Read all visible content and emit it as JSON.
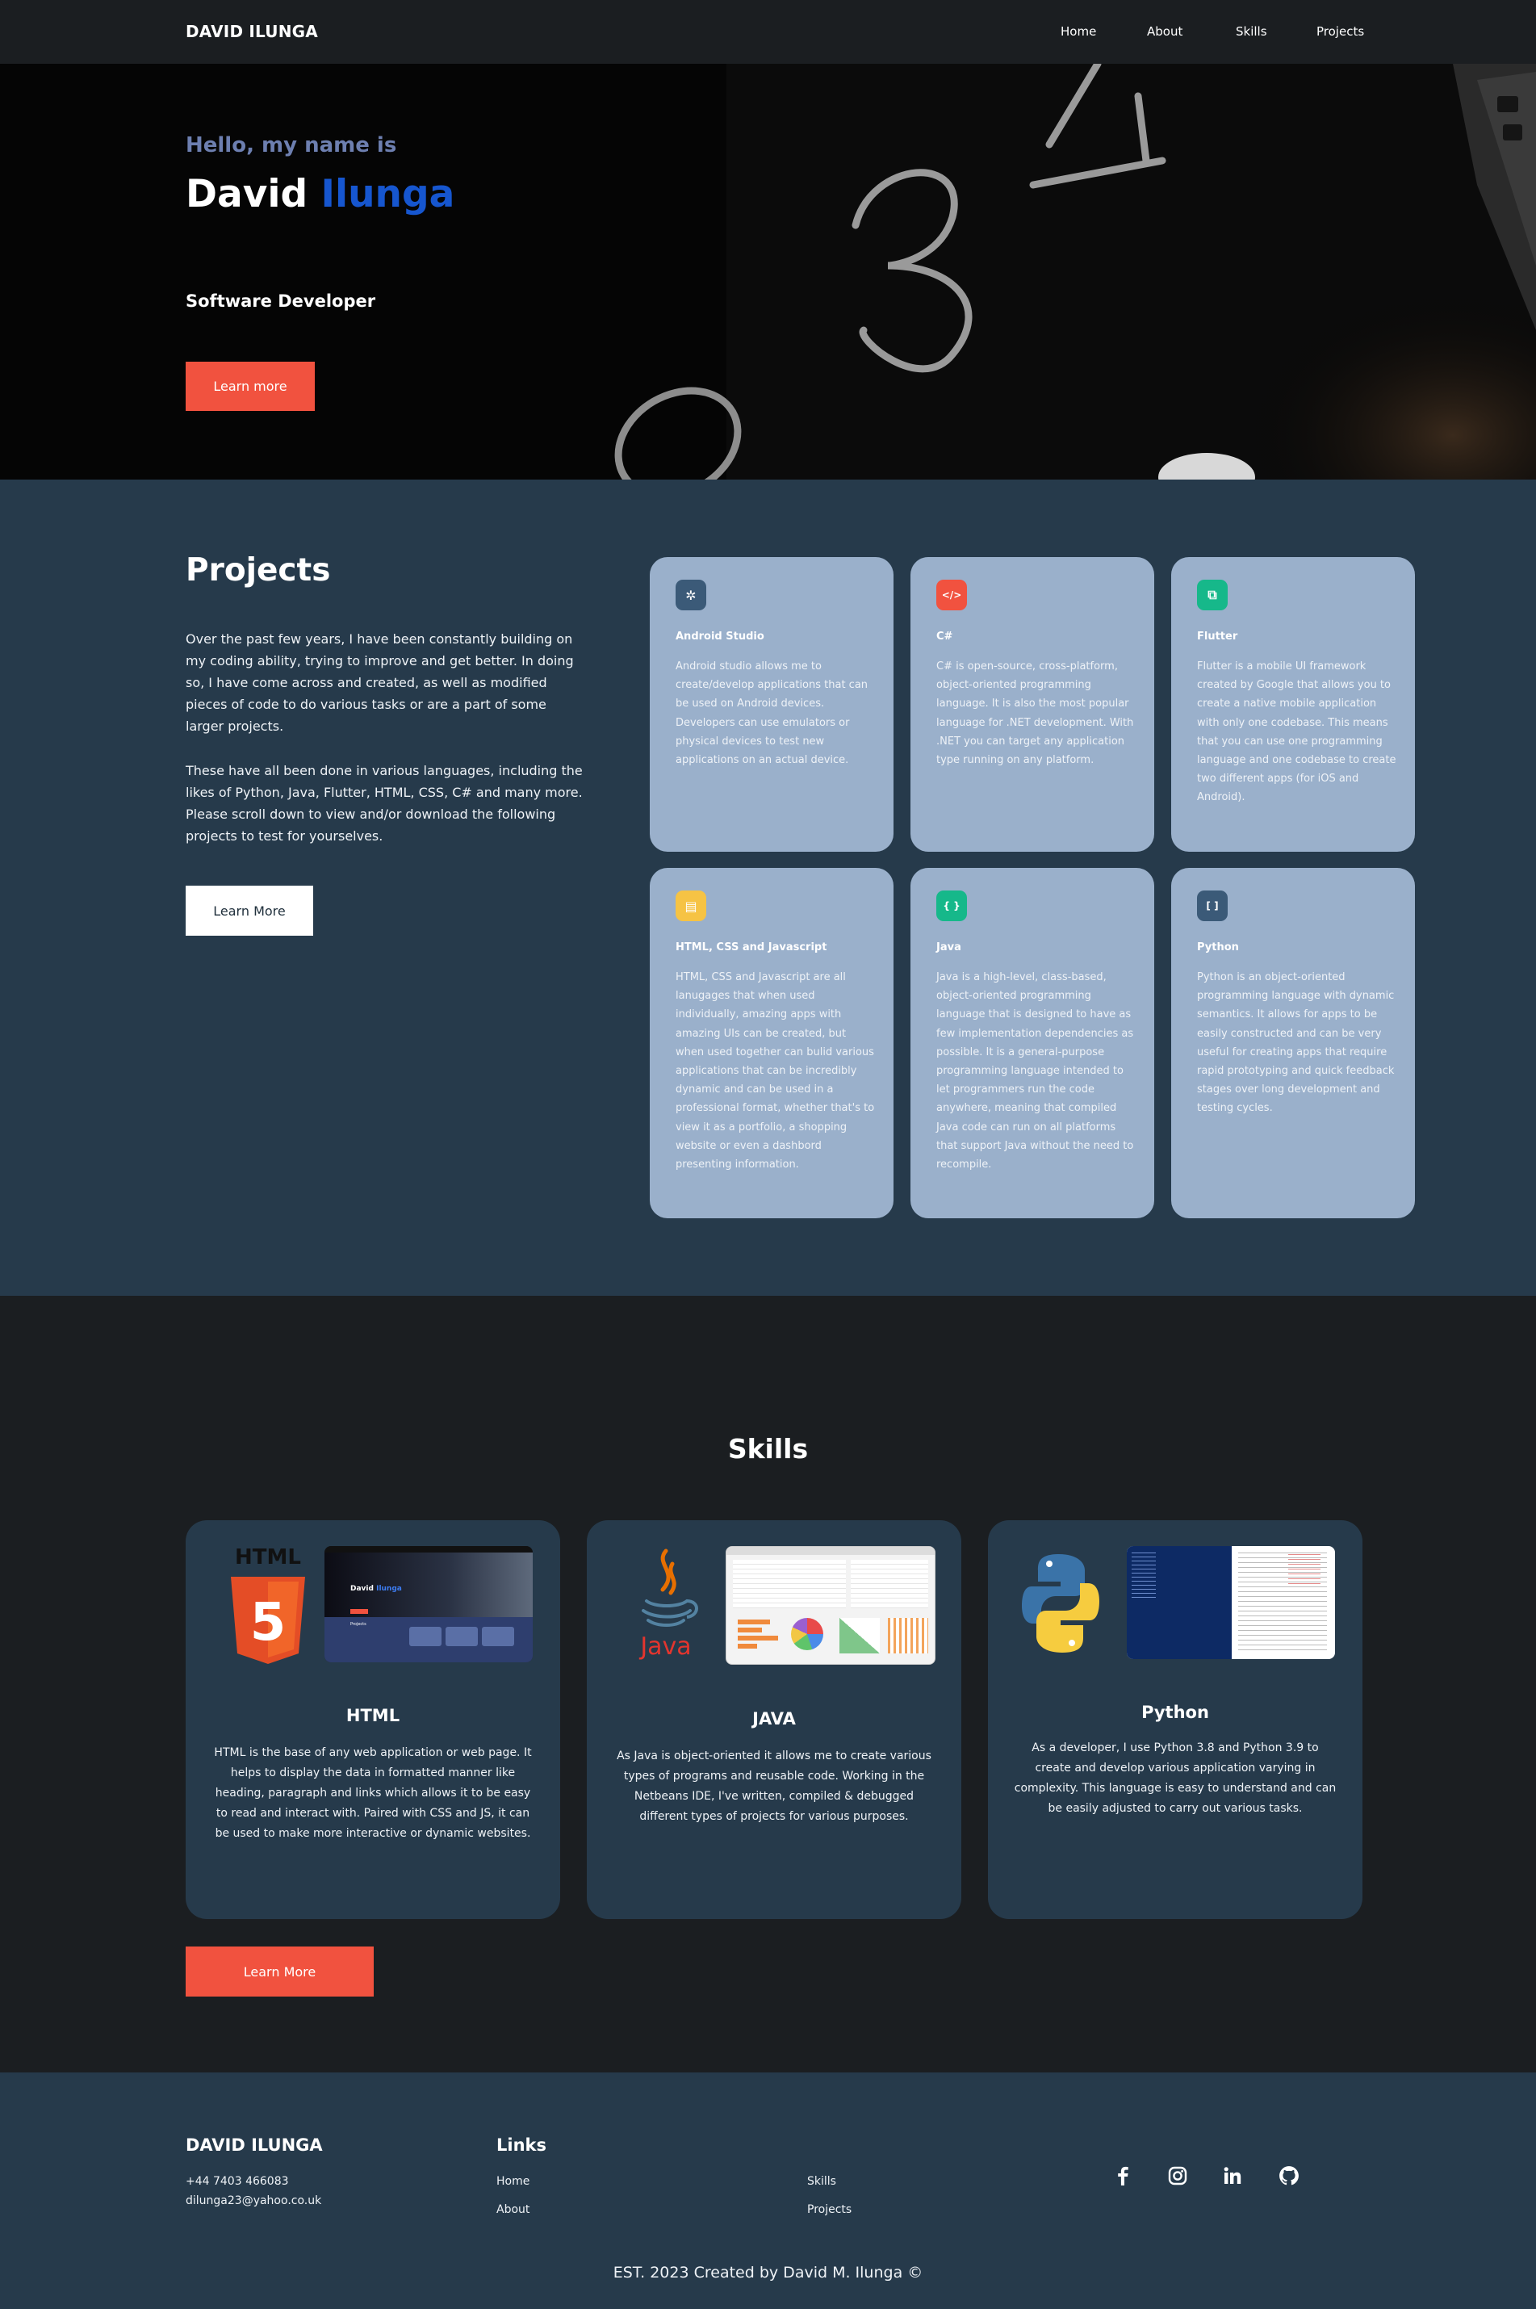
{
  "nav": {
    "brand": "DAVID ILUNGA",
    "links": [
      "Home",
      "About",
      "Skills",
      "Projects"
    ]
  },
  "hero": {
    "greeting": "Hello, my name is",
    "first_name": "David",
    "last_name": "Ilunga",
    "role": "Software Developer",
    "button": "Learn more"
  },
  "projects": {
    "title": "Projects",
    "paragraph1": "Over the past few years, I have been constantly building on my coding ability, trying to improve and get better. In doing so, I have come across and created, as well as modified pieces of code to do various tasks or are a part of some larger projects.",
    "paragraph2": "These have all been done in various languages, including the likes of Python, Java, Flutter, HTML, CSS, C# and many more. Please scroll down to view and/or download the following projects to test for yourselves.",
    "button": "Learn More",
    "cards": [
      {
        "icon": "bug-icon",
        "glyph": "✲",
        "color": "#3b5a78",
        "title": "Android Studio",
        "text": "Android studio allows me to create/develop applications that can be used on Android devices. Developers can use emulators or physical devices to test new applications on an actual device."
      },
      {
        "icon": "code-icon",
        "glyph": "</>",
        "color": "#f1523f",
        "title": "C#",
        "text": "C# is open-source, cross-platform, object-oriented programming language. It is also the most popular language for .NET development. With .NET you can target any application type running on any platform."
      },
      {
        "icon": "copy-icon",
        "glyph": "⧉",
        "color": "#16b88a",
        "title": "Flutter",
        "text": "Flutter is a mobile UI framework created by Google that allows you to create a native mobile application with only one codebase. This means that you can use one programming language and one codebase to create two different apps (for iOS and Android)."
      },
      {
        "icon": "html-icon",
        "glyph": "▤",
        "color": "#f6c344",
        "title": "HTML, CSS and Javascript",
        "text": "HTML, CSS and Javascript are all lanugages that when used individually, amazing apps with amazing UIs can be created, but when used together can bulid various applications that can be incredibly dynamic and can be used in a professional format, whether that's to view it as a portfolio, a shopping website or even a dashbord presenting information."
      },
      {
        "icon": "braces-icon",
        "glyph": "{ }",
        "color": "#16b88a",
        "title": "Java",
        "text": "Java is a high-level, class-based, object-oriented programming language that is designed to have as few implementation dependencies as possible. It is a general-purpose programming language intended to let programmers run the code anywhere, meaning that compiled Java code can run on all platforms that support Java without the need to recompile."
      },
      {
        "icon": "brackets-icon",
        "glyph": "[ ]",
        "color": "#3b5a78",
        "title": "Python",
        "text": "Python is an object-oriented programming language with dynamic semantics. It allows for apps to be easily constructed and can be very useful for creating apps that require rapid prototyping and quick feedback stages over long development and testing cycles."
      }
    ]
  },
  "skills": {
    "title": "Skills",
    "button": "Learn More",
    "cards": [
      {
        "logo": "html5-logo",
        "logo_text": "HTML",
        "logo_digit": "5",
        "name": "HTML",
        "text": "HTML is the base of any web application or web page. It helps to display the data in formatted manner like heading, paragraph and links which allows it to be easy to read and interact with. Paired with CSS and JS, it can be used to make more interactive or dynamic websites."
      },
      {
        "logo": "java-logo",
        "logo_text": "Java",
        "name": "JAVA",
        "text": "As Java is object-oriented it allows me to create various types of programs and reusable code. Working in the Netbeans IDE, I've written, compiled & debugged different types of projects for various purposes."
      },
      {
        "logo": "python-logo",
        "name": "Python",
        "text": "As a developer, I use Python 3.8 and Python 3.9 to create and develop various application varying in complexity. This language is easy to understand and can be easily adjusted to carry out various tasks."
      }
    ],
    "html_screenshot": {
      "first_name": "David",
      "last_name": "Ilunga",
      "section": "Projects"
    }
  },
  "footer": {
    "brand": "DAVID ILUNGA",
    "phone": "+44 7403 466083",
    "email": "dilunga23@yahoo.co.uk",
    "links_title": "Links",
    "links": [
      "Home",
      "About",
      "Skills",
      "Projects"
    ],
    "social": [
      "facebook-icon",
      "instagram-icon",
      "linkedin-icon",
      "github-icon"
    ],
    "copyright": "EST. 2023 Created by David M. Ilunga ©"
  },
  "colors": {
    "accent": "#f1523f",
    "name_blue": "#1656cf",
    "panel": "#263a4b",
    "card": "#9ab0cb",
    "dark": "#1b1e21"
  }
}
